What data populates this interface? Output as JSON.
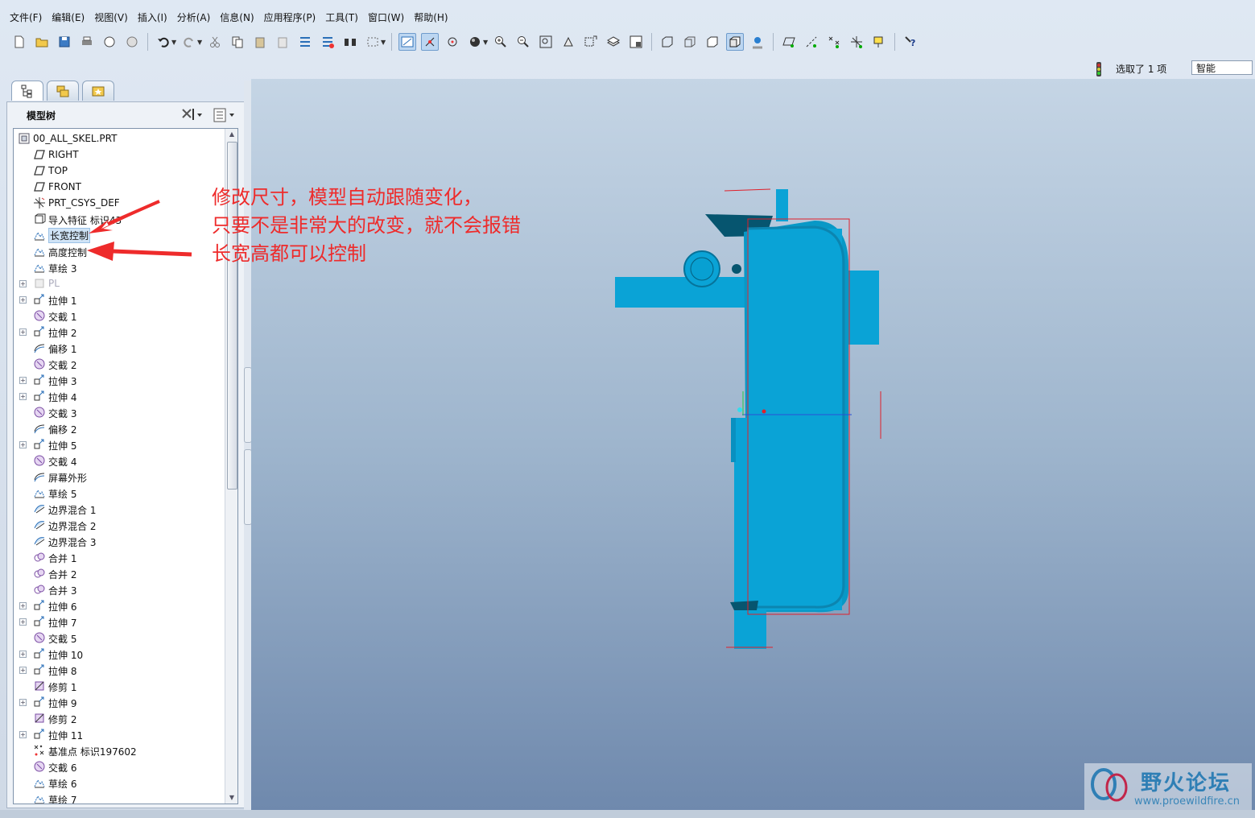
{
  "menu": [
    "文件(F)",
    "编辑(E)",
    "视图(V)",
    "插入(I)",
    "分析(A)",
    "信息(N)",
    "应用程序(P)",
    "工具(T)",
    "窗口(W)",
    "帮助(H)"
  ],
  "status": {
    "selection_text": "选取了 1 项",
    "filter_value": "智能"
  },
  "panel": {
    "title": "模型树"
  },
  "tree": [
    {
      "label": "00_ALL_SKEL.PRT",
      "icon": "part-icon",
      "root": true
    },
    {
      "label": "RIGHT",
      "icon": "datum-plane-icon"
    },
    {
      "label": "TOP",
      "icon": "datum-plane-icon"
    },
    {
      "label": "FRONT",
      "icon": "datum-plane-icon"
    },
    {
      "label": "PRT_CSYS_DEF",
      "icon": "csys-icon"
    },
    {
      "label": "导入特征 标识43",
      "icon": "import-feature-icon"
    },
    {
      "label": "长宽控制",
      "icon": "sketch-icon",
      "highlight": true
    },
    {
      "label": "高度控制",
      "icon": "sketch-icon"
    },
    {
      "label": "草绘 3",
      "icon": "sketch-icon"
    },
    {
      "label": "PL",
      "icon": "layer-icon",
      "expand": true,
      "dim": true
    },
    {
      "label": "拉伸 1",
      "icon": "extrude-icon",
      "expand": true
    },
    {
      "label": "交截 1",
      "icon": "intersect-icon"
    },
    {
      "label": "拉伸 2",
      "icon": "extrude-icon",
      "expand": true
    },
    {
      "label": "偏移 1",
      "icon": "offset-icon"
    },
    {
      "label": "交截 2",
      "icon": "intersect-icon"
    },
    {
      "label": "拉伸 3",
      "icon": "extrude-icon",
      "expand": true
    },
    {
      "label": "拉伸 4",
      "icon": "extrude-icon",
      "expand": true
    },
    {
      "label": "交截 3",
      "icon": "intersect-icon"
    },
    {
      "label": "偏移 2",
      "icon": "offset-icon"
    },
    {
      "label": "拉伸 5",
      "icon": "extrude-icon",
      "expand": true
    },
    {
      "label": "交截 4",
      "icon": "intersect-icon"
    },
    {
      "label": "屏幕外形",
      "icon": "offset-icon"
    },
    {
      "label": "草绘 5",
      "icon": "sketch-icon"
    },
    {
      "label": "边界混合 1",
      "icon": "boundary-blend-icon"
    },
    {
      "label": "边界混合 2",
      "icon": "boundary-blend-icon"
    },
    {
      "label": "边界混合 3",
      "icon": "boundary-blend-icon"
    },
    {
      "label": "合并 1",
      "icon": "merge-icon"
    },
    {
      "label": "合并 2",
      "icon": "merge-icon"
    },
    {
      "label": "合并 3",
      "icon": "merge-icon"
    },
    {
      "label": "拉伸 6",
      "icon": "extrude-icon",
      "expand": true
    },
    {
      "label": "拉伸 7",
      "icon": "extrude-icon",
      "expand": true
    },
    {
      "label": "交截 5",
      "icon": "intersect-icon"
    },
    {
      "label": "拉伸 10",
      "icon": "extrude-icon",
      "expand": true
    },
    {
      "label": "拉伸 8",
      "icon": "extrude-icon",
      "expand": true
    },
    {
      "label": "修剪 1",
      "icon": "trim-icon"
    },
    {
      "label": "拉伸 9",
      "icon": "extrude-icon",
      "expand": true
    },
    {
      "label": "修剪 2",
      "icon": "trim-icon"
    },
    {
      "label": "拉伸 11",
      "icon": "extrude-icon",
      "expand": true
    },
    {
      "label": "基准点 标识197602",
      "icon": "datum-point-icon"
    },
    {
      "label": "交截 6",
      "icon": "intersect-icon"
    },
    {
      "label": "草绘 6",
      "icon": "sketch-icon"
    },
    {
      "label": "草绘 7",
      "icon": "sketch-icon"
    }
  ],
  "annotation": {
    "lines": [
      "修改尺寸，模型自动跟随变化，",
      "只要不是非常大的改变，就不会报错",
      "长宽高都可以控制"
    ],
    "color": "#ee2b2b"
  },
  "watermark": {
    "brand": "野火论坛",
    "url": "www.proewildfire.cn"
  },
  "colors": {
    "model": "#0aa3d6",
    "model_dark": "#06739a",
    "selection": "#e0202a"
  }
}
